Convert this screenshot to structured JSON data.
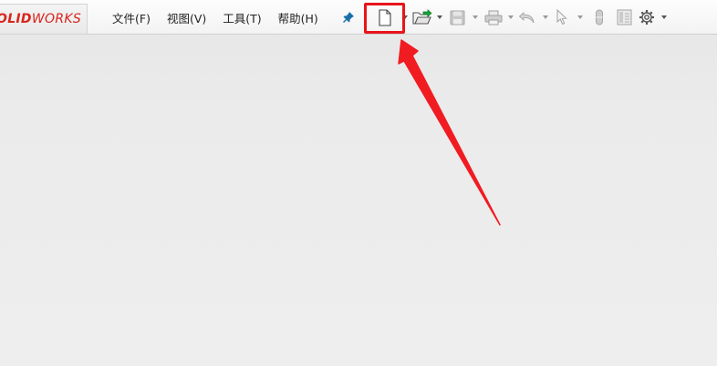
{
  "app": {
    "logo_bold": "OLID",
    "logo_light": "WORKS",
    "brand_color": "#d9251d"
  },
  "menu": {
    "items": [
      {
        "label": "文件(F)"
      },
      {
        "label": "视图(V)"
      },
      {
        "label": "工具(T)"
      },
      {
        "label": "帮助(H)"
      }
    ]
  },
  "toolbar": {
    "icons": [
      "pin-icon",
      "new-document-icon",
      "open-folder-icon",
      "save-icon",
      "print-icon",
      "undo-icon",
      "select-cursor-icon",
      "rebuild-icon",
      "file-properties-icon",
      "options-gear-icon"
    ],
    "highlight_color": "#e8141a",
    "arrow_color": "#f01c22"
  }
}
